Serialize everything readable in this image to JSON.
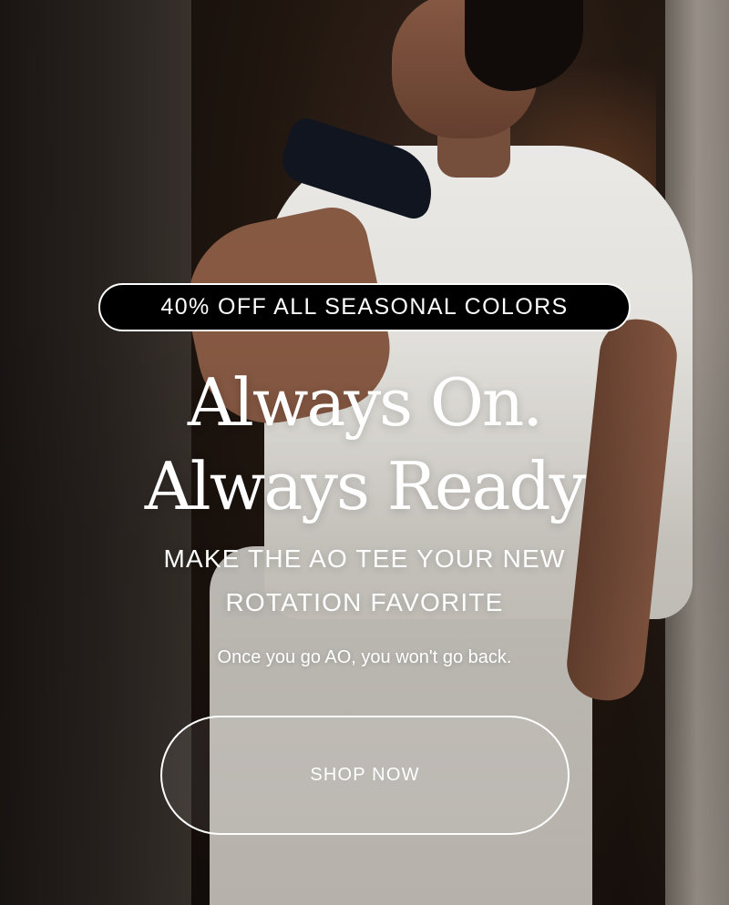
{
  "promo": {
    "badge_text": "40% OFF ALL SEASONAL COLORS",
    "headline_line1": "Always On.",
    "headline_line2": "Always Ready",
    "subheadline_line1": "MAKE THE AO TEE YOUR NEW",
    "subheadline_line2": "ROTATION FAVORITE",
    "tagline": "Once you go AO, you won't go back.",
    "cta_label": "SHOP NOW"
  }
}
